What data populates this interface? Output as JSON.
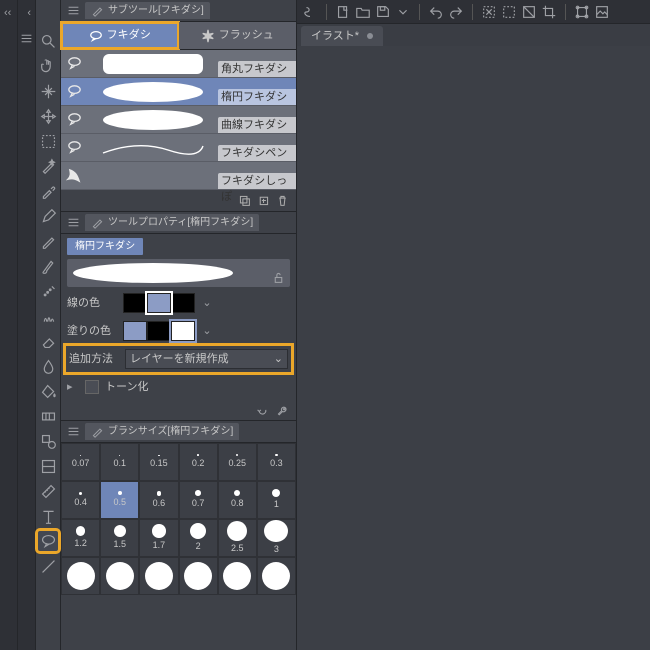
{
  "doc_tab": {
    "name": "イラスト*"
  },
  "subtool_panel": {
    "title": "サブツール[フキダシ]",
    "cats": [
      {
        "label": "フキダシ",
        "selected": true
      },
      {
        "label": "フラッシュ",
        "selected": false
      }
    ],
    "items": [
      {
        "label": "角丸フキダシ",
        "shape": "rr"
      },
      {
        "label": "楕円フキダシ",
        "shape": "el",
        "selected": true
      },
      {
        "label": "曲線フキダシ",
        "shape": "el"
      },
      {
        "label": "フキダシペン",
        "shape": "line"
      },
      {
        "label": "フキダシしっぽ",
        "shape": "tail"
      }
    ]
  },
  "tool_prop": {
    "title": "ツールプロパティ[楕円フキダシ]",
    "tool_label": "楕円フキダシ",
    "line_color": {
      "label": "線の色",
      "swatches": [
        "#000000",
        "#8c9cc5",
        "#000000"
      ]
    },
    "fill_color": {
      "label": "塗りの色",
      "swatches": [
        "#8c9cc5",
        "#000000",
        "#ffffff"
      ]
    },
    "add_method": {
      "label": "追加方法",
      "value": "レイヤーを新規作成"
    },
    "tone": {
      "label": "トーン化"
    }
  },
  "brush_size": {
    "title": "ブラシサイズ[楕円フキダシ]",
    "values": [
      0.07,
      0.1,
      0.15,
      0.2,
      0.25,
      0.3,
      0.4,
      0.5,
      0.6,
      0.7,
      0.8,
      1,
      1.2,
      1.5,
      1.7,
      2,
      2.5,
      3
    ],
    "selected": 7
  }
}
